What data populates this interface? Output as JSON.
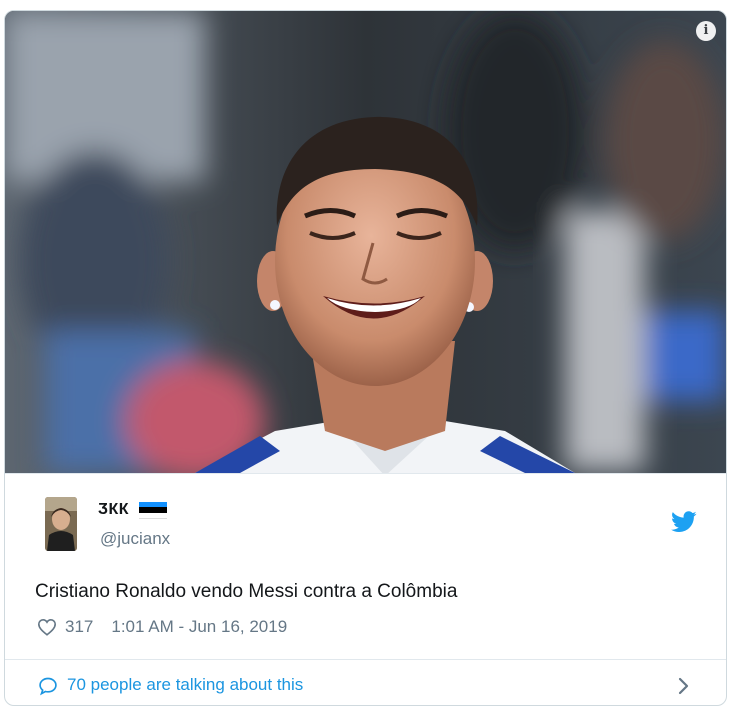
{
  "tweet": {
    "display_name": "ӠКК",
    "handle": "@jucianx",
    "flag_colors": [
      "#1291ff",
      "#000000",
      "#ffffff"
    ],
    "text": "Cristiano Ronaldo vendo Messi contra a Colômbia",
    "likes": "317",
    "timestamp": "1:01 AM - Jun 16, 2019",
    "talking_about": "70 people are talking about this"
  },
  "icons": {
    "info": "info-icon",
    "brand": "twitter-bird-icon",
    "like": "heart-icon",
    "reply": "speech-bubble-icon",
    "more": "chevron-right-icon"
  },
  "colors": {
    "link": "#1b95e0",
    "secondary_text": "#657786",
    "border": "#cfd9de",
    "twitter_blue": "#1da1f2"
  }
}
